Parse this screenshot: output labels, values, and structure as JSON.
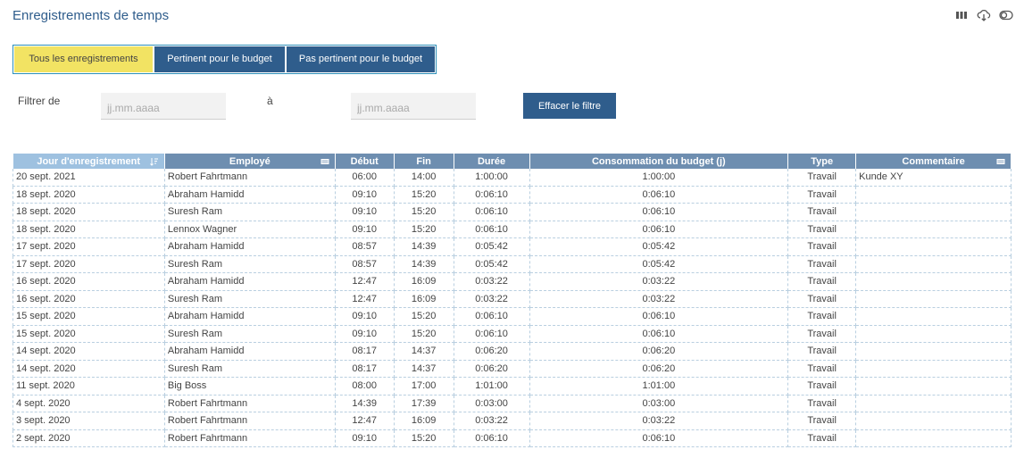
{
  "page": {
    "title": "Enregistrements de temps"
  },
  "toolbar_icons": [
    "columns-icon",
    "download-cloud-icon",
    "toggle-icon"
  ],
  "tabs": [
    {
      "label": "Tous les enregistrements",
      "active": true
    },
    {
      "label": "Pertinent pour le budget",
      "active": false
    },
    {
      "label": "Pas pertinent pour le budget",
      "active": false
    }
  ],
  "filter": {
    "from_label": "Filtrer de",
    "to_label": "à",
    "from_placeholder": "jj.mm.aaaa",
    "to_placeholder": "jj.mm.aaaa",
    "clear_label": "Effacer le filtre"
  },
  "table": {
    "columns": [
      "Jour d'enregistrement",
      "Employé",
      "Début",
      "Fin",
      "Durée",
      "Consommation du budget (j)",
      "Type",
      "Commentaire"
    ],
    "rows": [
      [
        "20 sept. 2021",
        "Robert Fahrtmann",
        "06:00",
        "14:00",
        "1:00:00",
        "1:00:00",
        "Travail",
        "Kunde XY"
      ],
      [
        "18 sept. 2020",
        "Abraham Hamidd",
        "09:10",
        "15:20",
        "0:06:10",
        "0:06:10",
        "Travail",
        ""
      ],
      [
        "18 sept. 2020",
        "Suresh Ram",
        "09:10",
        "15:20",
        "0:06:10",
        "0:06:10",
        "Travail",
        ""
      ],
      [
        "18 sept. 2020",
        "Lennox Wagner",
        "09:10",
        "15:20",
        "0:06:10",
        "0:06:10",
        "Travail",
        ""
      ],
      [
        "17 sept. 2020",
        "Abraham Hamidd",
        "08:57",
        "14:39",
        "0:05:42",
        "0:05:42",
        "Travail",
        ""
      ],
      [
        "17 sept. 2020",
        "Suresh Ram",
        "08:57",
        "14:39",
        "0:05:42",
        "0:05:42",
        "Travail",
        ""
      ],
      [
        "16 sept. 2020",
        "Abraham Hamidd",
        "12:47",
        "16:09",
        "0:03:22",
        "0:03:22",
        "Travail",
        ""
      ],
      [
        "16 sept. 2020",
        "Suresh Ram",
        "12:47",
        "16:09",
        "0:03:22",
        "0:03:22",
        "Travail",
        ""
      ],
      [
        "15 sept. 2020",
        "Abraham Hamidd",
        "09:10",
        "15:20",
        "0:06:10",
        "0:06:10",
        "Travail",
        ""
      ],
      [
        "15 sept. 2020",
        "Suresh Ram",
        "09:10",
        "15:20",
        "0:06:10",
        "0:06:10",
        "Travail",
        ""
      ],
      [
        "14 sept. 2020",
        "Abraham Hamidd",
        "08:17",
        "14:37",
        "0:06:20",
        "0:06:20",
        "Travail",
        ""
      ],
      [
        "14 sept. 2020",
        "Suresh Ram",
        "08:17",
        "14:37",
        "0:06:20",
        "0:06:20",
        "Travail",
        ""
      ],
      [
        "11 sept. 2020",
        "Big Boss",
        "08:00",
        "17:00",
        "1:01:00",
        "1:01:00",
        "Travail",
        ""
      ],
      [
        "4 sept. 2020",
        "Robert Fahrtmann",
        "14:39",
        "17:39",
        "0:03:00",
        "0:03:00",
        "Travail",
        ""
      ],
      [
        "3 sept. 2020",
        "Robert Fahrtmann",
        "12:47",
        "16:09",
        "0:03:22",
        "0:03:22",
        "Travail",
        ""
      ],
      [
        "2 sept. 2020",
        "Robert Fahrtmann",
        "09:10",
        "15:20",
        "0:06:10",
        "0:06:10",
        "Travail",
        ""
      ]
    ]
  }
}
